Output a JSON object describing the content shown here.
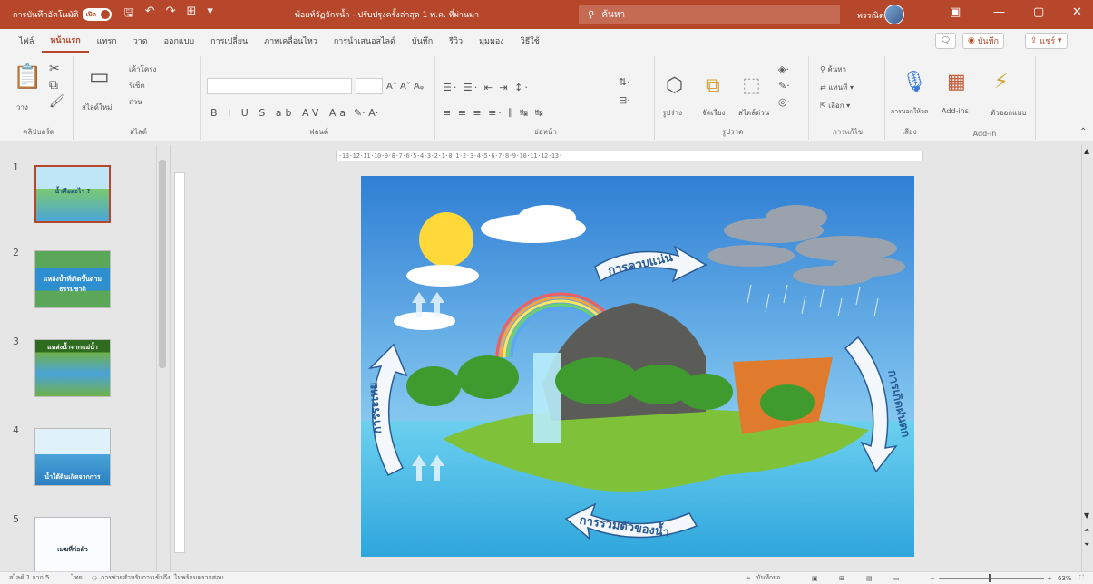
{
  "titlebar": {
    "autosave_label": "การบันทึกอัตโนมัติ",
    "autosave_state": "เปิด",
    "doc_title": "พ้อยท์วัฏจักรน้ำ - ปรับปรุงครั้งล่าสุด 1 พ.ค. ที่ผ่านมา",
    "search_placeholder": "ค้นหา",
    "user_name": "พรรณิดล"
  },
  "tabs": [
    "ไฟล์",
    "หน้าแรก",
    "แทรก",
    "วาด",
    "ออกแบบ",
    "การเปลี่ยน",
    "ภาพเคลื่อนไหว",
    "การนำเสนอสไลด์",
    "บันทึก",
    "รีวิว",
    "มุมมอง",
    "วิธีใช้"
  ],
  "active_tab": "หน้าแรก",
  "tab_right": {
    "record_label": "บันทึก",
    "share_label": "แชร์"
  },
  "ribbon": {
    "groups": [
      "คลิปบอร์ด",
      "สไลด์",
      "ฟอนต์",
      "ย่อหน้า",
      "รูปวาด",
      "การแก้ไข",
      "เสียง",
      "Add-in"
    ],
    "paste_label": "วาง",
    "new_slide_label": "สไลด์ใหม่",
    "layout_label": "เค้าโครง",
    "reset_label": "รีเซ็ต",
    "section_label": "ส่วน",
    "shapes_label": "รูปร่าง",
    "arrange_label": "จัดเรียง",
    "quick_styles_label": "สไตล์ด่วน",
    "find_label": "ค้นหา",
    "replace_label": "แทนที่",
    "select_label": "เลือก",
    "dictate_label": "การบอกให้จด",
    "addins_label": "Add-ins",
    "designer_label": "ตัวออกแบบ"
  },
  "thumbnails": [
    {
      "num": "1",
      "caption": "น้ำคืออะไร ?"
    },
    {
      "num": "2",
      "caption": "แหล่งน้ำที่เกิดขึ้นตามธรรมชาติ"
    },
    {
      "num": "3",
      "caption": "แหล่งน้ำจากแม่น้ำ"
    },
    {
      "num": "4",
      "caption": "น้ำใต้ดินเกิดจากการ"
    },
    {
      "num": "5",
      "caption": "เมฆที่ก่อตัว"
    }
  ],
  "ruler": "·13·12·11·10·9·8·7·6·5·4·3·2·1·0·1·2·3·4·5·6·7·8·9·10·11·12·13·",
  "slide": {
    "labels": {
      "condensation": "การควบแน่น",
      "precipitation": "การเกิดฝนตก",
      "collection": "การรวมตัวของน้ำ",
      "evaporation": "การระเหย"
    }
  },
  "status": {
    "slide_info": "สไลด์ 1 จาก 5",
    "language": "ไทย",
    "accessibility": "การช่วยสำหรับการเข้าถึง: ไม่พร้อมตรวจสอบ",
    "notes_label": "บันทึกย่อ",
    "zoom": "63%"
  },
  "colors": {
    "accent": "#b7472a",
    "sky": "#2f7fd4",
    "water": "#5ec4e8",
    "arrow": "#2a5d96"
  }
}
